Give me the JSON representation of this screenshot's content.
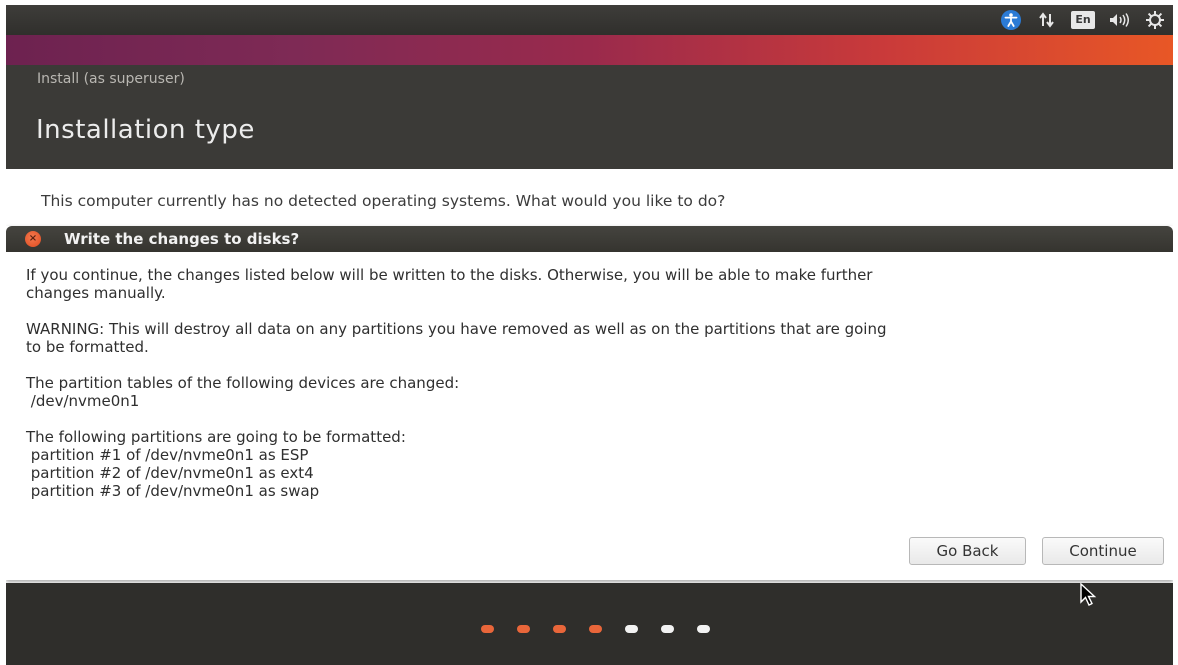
{
  "top_panel": {
    "language_indicator": "En",
    "icons": [
      "accessibility-icon",
      "network-icon",
      "keyboard-language-icon",
      "volume-icon",
      "power-settings-icon"
    ]
  },
  "window": {
    "title": "Install (as superuser)",
    "page_title": "Installation type",
    "question": "This computer currently has no detected operating systems. What would you like to do?"
  },
  "dialog": {
    "title": "Write the changes to disks?",
    "intro_line1": "If you continue, the changes listed below will be written to the disks. Otherwise, you will be able to make further",
    "intro_line2": "changes manually.",
    "warning_line1": "WARNING: This will destroy all data on any partitions you have removed as well as on the partitions that are going",
    "warning_line2": "to be formatted.",
    "tables_heading": "The partition tables of the following devices are changed:",
    "tables_devices": [
      " /dev/nvme0n1"
    ],
    "format_heading": "The following partitions are going to be formatted:",
    "format_partitions": [
      " partition #1 of /dev/nvme0n1 as ESP",
      " partition #2 of /dev/nvme0n1 as ext4",
      " partition #3 of /dev/nvme0n1 as swap"
    ],
    "buttons": {
      "go_back": "Go Back",
      "continue": "Continue"
    }
  },
  "progress": {
    "steps_total": 7,
    "steps_done": 4,
    "active_color": "#e9663a",
    "inactive_color": "#f2f2f2"
  },
  "colors": {
    "dialog_close": "#e0502a",
    "header_bg": "#3b3a37"
  }
}
